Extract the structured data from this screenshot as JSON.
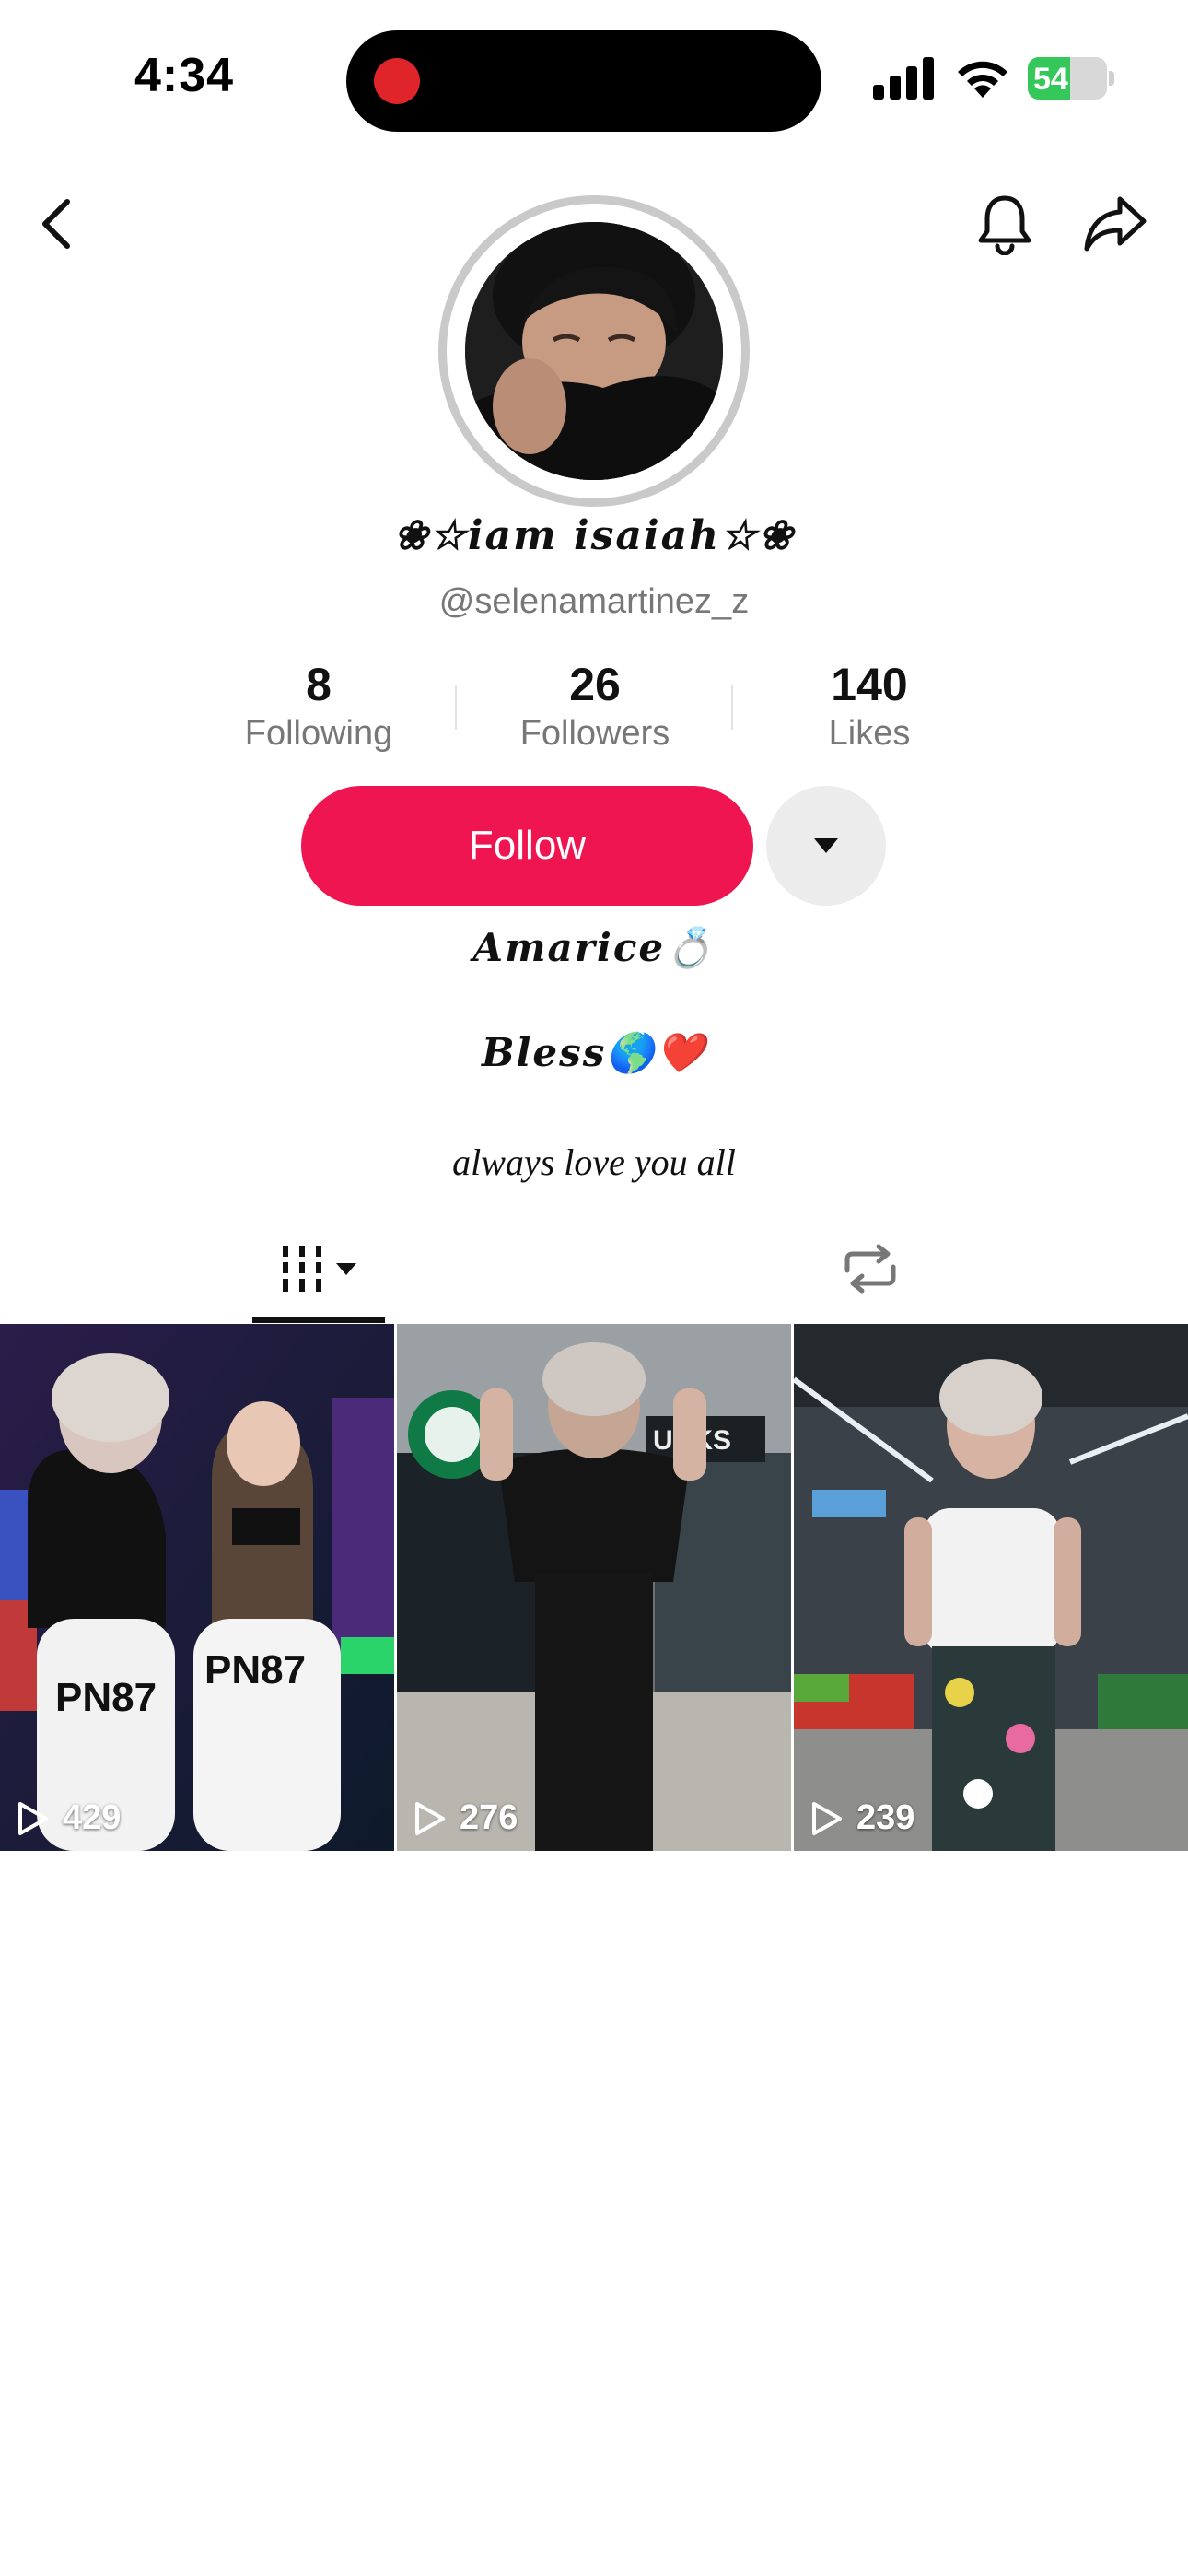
{
  "status_bar": {
    "time": "4:34",
    "battery_level": "54",
    "battery_fraction": 0.54,
    "recording_indicator_color": "#e0252a"
  },
  "nav": {
    "back_icon": "chevron-left-icon",
    "bell_icon": "bell-icon",
    "share_icon": "share-arrow-icon"
  },
  "profile": {
    "display_name": "❀☆iam isaiah☆❀",
    "username": "@selenamartinez_z",
    "stats": [
      {
        "value": "8",
        "label": "Following"
      },
      {
        "value": "26",
        "label": "Followers"
      },
      {
        "value": "140",
        "label": "Likes"
      }
    ],
    "follow_label": "Follow",
    "bio": [
      "Amarice💍",
      "Bless🌎❤️",
      "always love you all"
    ]
  },
  "tabs": {
    "videos_icon": "video-grid-icon",
    "reposts_icon": "repost-icon"
  },
  "videos": [
    {
      "views": "429",
      "scene": "arcade couple"
    },
    {
      "views": "276",
      "scene": "mall storefront"
    },
    {
      "views": "239",
      "scene": "grocery store"
    }
  ],
  "colors": {
    "accent": "#ee1550",
    "muted_text": "#777777",
    "battery": "#34c759"
  }
}
